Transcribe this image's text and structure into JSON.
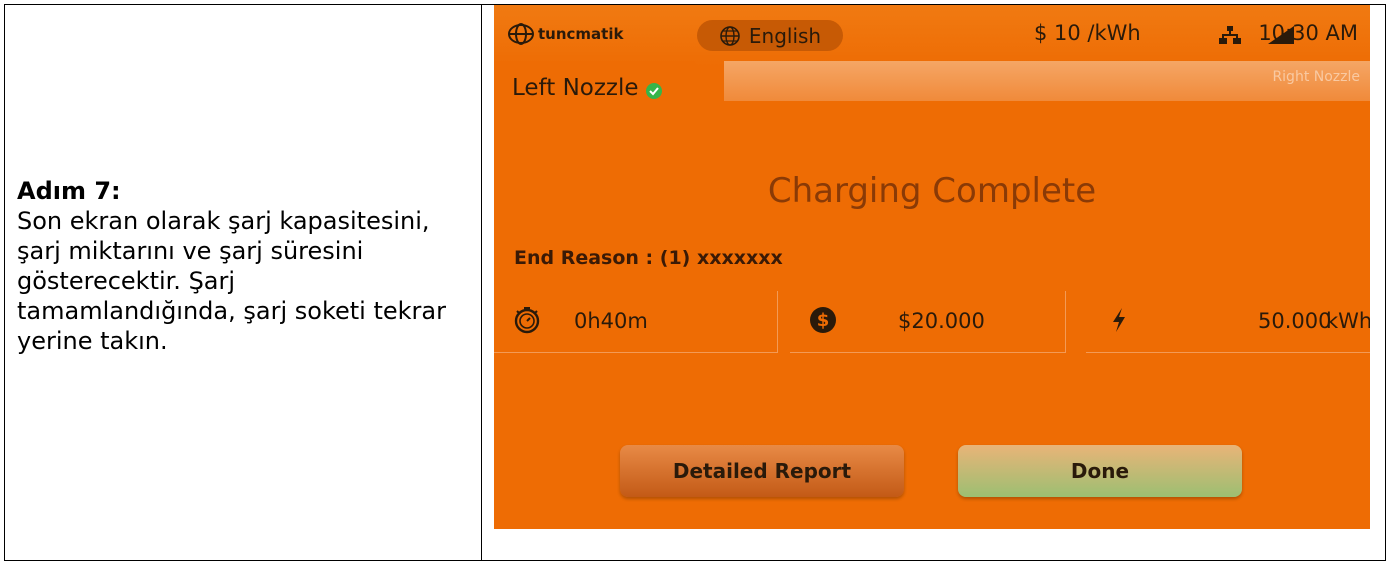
{
  "document": {
    "step_title": "Adım 7:",
    "step_body": "Son ekran olarak şarj kapasitesini, şarj miktarını ve şarj süresini gösterecektir. Şarj tamamlandığında, şarj soketi tekrar yerine takın."
  },
  "status_bar": {
    "brand": "tuncmatik",
    "language": "English",
    "price": "$ 10 /kWh",
    "time": "10:30 AM",
    "icons": [
      "globe-icon",
      "network-icon",
      "signal-icon"
    ]
  },
  "tabs": {
    "left": "Left Nozzle",
    "right": "Right Nozzle"
  },
  "main": {
    "heading": "Charging Complete",
    "end_reason": "End Reason : (1) xxxxxxx",
    "stats": {
      "duration": "0h40m",
      "cost": "$20.000",
      "energy": "50.000",
      "energy_unit": "kWh"
    }
  },
  "buttons": {
    "report": "Detailed Report",
    "done": "Done"
  },
  "colors": {
    "screen_bg": "#ee6c04",
    "status_ok": "#35b54a",
    "heading": "#8a3a06"
  }
}
